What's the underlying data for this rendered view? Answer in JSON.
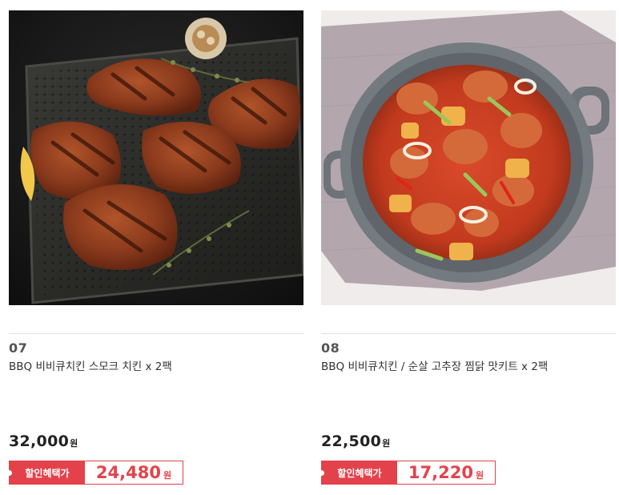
{
  "products": [
    {
      "number": "07",
      "name": "BBQ 비비큐치킨 스모크 치킨 x 2팩",
      "price": "32,000",
      "price_unit": "원",
      "discount_label": "할인혜택가",
      "discount_price": "24,480",
      "discount_unit": "원",
      "image_icon": "smoked-chicken-photo"
    },
    {
      "number": "08",
      "name": "BBQ 비비큐치킨 / 순살 고추장 찜닭 맛키트 x 2팩",
      "price": "22,500",
      "price_unit": "원",
      "discount_label": "할인혜택가",
      "discount_price": "17,220",
      "discount_unit": "원",
      "image_icon": "braised-chicken-pot-photo"
    }
  ],
  "colors": {
    "accent": "#e4424b",
    "text": "#222222",
    "divider": "#e2e2e2"
  }
}
